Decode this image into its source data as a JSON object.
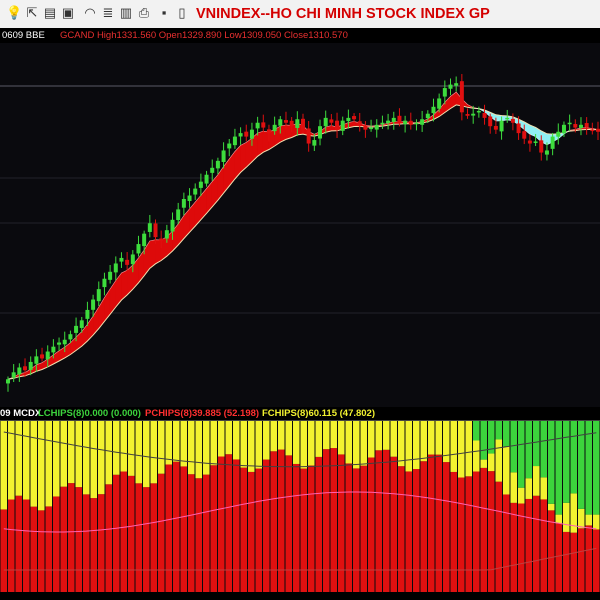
{
  "toolbar": {
    "icons": [
      "lightbulb-icon",
      "cursor-icon",
      "chart-icon",
      "image-icon",
      "wifi-icon",
      "stack-icon",
      "briefcase-icon",
      "printer-icon",
      "save-icon",
      "document-icon",
      "layers-icon"
    ],
    "title": "VNINDEX--HO CHI MINH STOCK INDEX  GP"
  },
  "info": {
    "date_code": "0609 BBE",
    "ohlc_text": "GCAND High1331.560 Open1329.890 Low1309.050 Close1310.570"
  },
  "indicator": {
    "prefix": "09 MCDX",
    "lchips": "LCHIPS(8)0.000 (0.000)",
    "pchips": "PCHIPS(8)39.885 (52.198)",
    "fchips": "FCHIPS(8)60.115 (47.802)"
  },
  "colors": {
    "bull_candle": "#3ddc3d",
    "bear_candle": "#e01010",
    "ribbon_bull": "#dd0a0a",
    "ribbon_bear": "#8ff0f4",
    "chips_red": "#e01010",
    "chips_yellow": "#f2f230",
    "chips_green": "#3cd33c",
    "title": "#d40000"
  },
  "chart_data": [
    {
      "type": "candlestick",
      "title": "VNINDEX--HO CHI MINH STOCK INDEX  GP",
      "last_bar": {
        "high": 1331.56,
        "open": 1329.89,
        "low": 1309.05,
        "close": 1310.57
      },
      "ylim": [
        845,
        1370
      ],
      "overlay": "moving-average ribbon (red when fast above slow, cyan when below)",
      "closes": [
        885,
        895,
        902,
        898,
        910,
        918,
        915,
        925,
        932,
        938,
        942,
        950,
        962,
        970,
        985,
        1000,
        1015,
        1030,
        1040,
        1052,
        1060,
        1050,
        1065,
        1080,
        1095,
        1110,
        1090,
        1085,
        1100,
        1115,
        1130,
        1145,
        1150,
        1160,
        1170,
        1180,
        1190,
        1200,
        1215,
        1225,
        1235,
        1240,
        1235,
        1245,
        1255,
        1248,
        1240,
        1252,
        1260,
        1255,
        1250,
        1260,
        1245,
        1225,
        1230,
        1250,
        1262,
        1255,
        1245,
        1258,
        1262,
        1260,
        1250,
        1245,
        1248,
        1252,
        1255,
        1258,
        1262,
        1255,
        1258,
        1252,
        1255,
        1260,
        1268,
        1278,
        1290,
        1305,
        1310,
        1312,
        1270,
        1265,
        1268,
        1272,
        1262,
        1250,
        1245,
        1258,
        1262,
        1255,
        1240,
        1232,
        1225,
        1228,
        1212,
        1215,
        1235,
        1242,
        1252,
        1255,
        1248,
        1252,
        1248,
        1245,
        1242
      ]
    },
    {
      "type": "stacked-bar",
      "title": "MCDX",
      "series": [
        {
          "name": "LCHIPS(8)",
          "last": 0.0,
          "prev": 0.0
        },
        {
          "name": "PCHIPS(8)",
          "last": 39.885,
          "prev": 52.198
        },
        {
          "name": "FCHIPS(8)",
          "last": 60.115,
          "prev": 47.802
        }
      ],
      "ylim": [
        0,
        100
      ]
    }
  ]
}
